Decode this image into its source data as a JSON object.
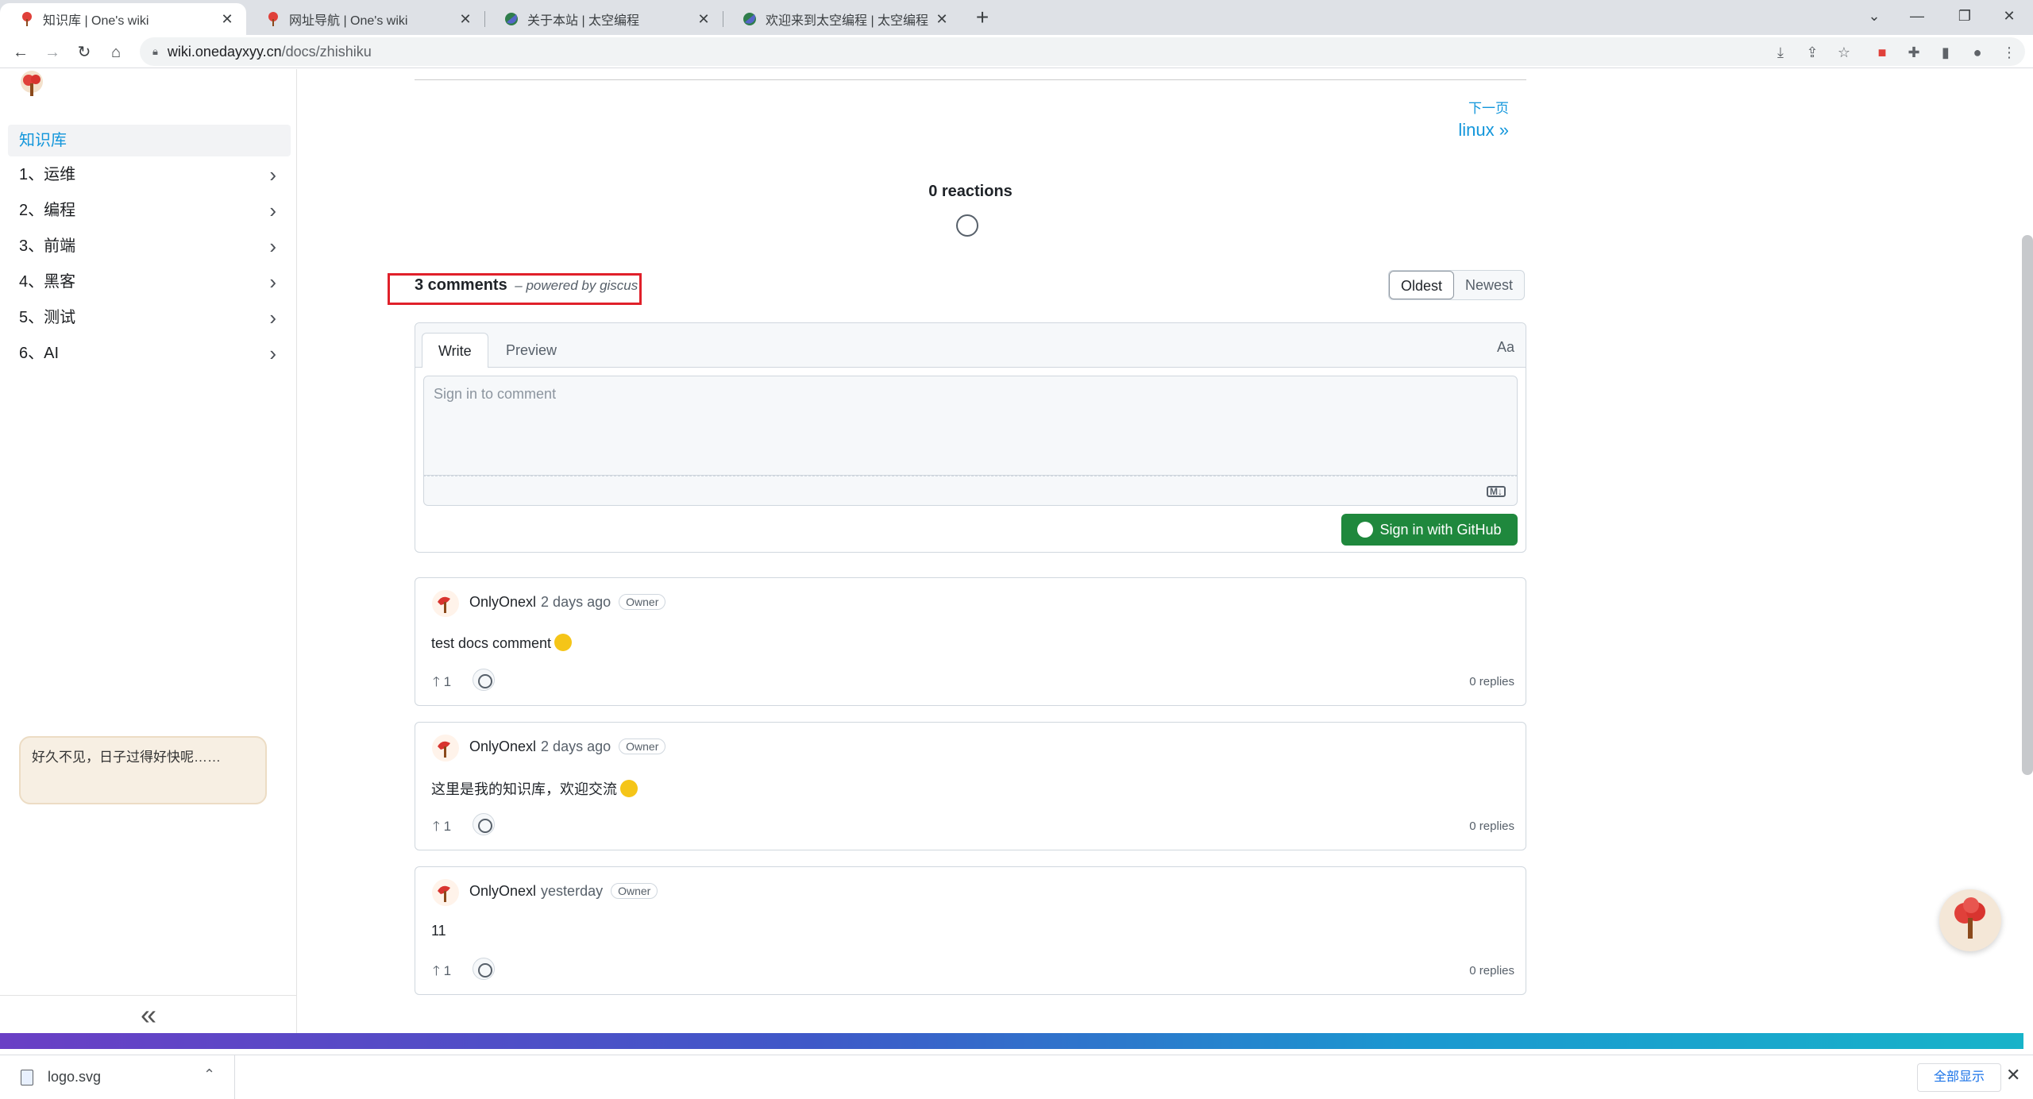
{
  "browser": {
    "tabs": [
      {
        "title": "知识库 | One's wiki",
        "active": true
      },
      {
        "title": "网址导航 | One's wiki",
        "active": false
      },
      {
        "title": "关于本站 | 太空编程",
        "active": false
      },
      {
        "title": "欢迎来到太空编程 | 太空编程",
        "active": false
      }
    ],
    "new_tab": "+",
    "url_host": "wiki.onedayxyy.cn",
    "url_path": "/docs/zhishiku"
  },
  "sidebar": {
    "active_item": "知识库",
    "items": [
      {
        "label": "1、运维"
      },
      {
        "label": "2、编程"
      },
      {
        "label": "3、前端"
      },
      {
        "label": "4、黑客"
      },
      {
        "label": "5、测试"
      },
      {
        "label": "6、AI"
      }
    ],
    "bubble_text": "好久不见，日子过得好快呢……",
    "collapse_glyph": "«"
  },
  "pager": {
    "next_sub": "下一页",
    "next_label": "linux »"
  },
  "reactions": {
    "label": "0 reactions"
  },
  "comments": {
    "count_label": "3 comments",
    "powered_by": "– powered by giscus",
    "sort_oldest": "Oldest",
    "sort_newest": "Newest",
    "editor": {
      "tab_write": "Write",
      "tab_preview": "Preview",
      "aa_label": "Aa",
      "placeholder": "Sign in to comment",
      "md_icon": "M↓",
      "signin_label": "Sign in with GitHub"
    },
    "list": [
      {
        "author": "OnlyOnexl",
        "time": "2 days ago",
        "badge": "Owner",
        "body": "test docs comment",
        "upvotes": "1",
        "replies": "0 replies"
      },
      {
        "author": "OnlyOnexl",
        "time": "2 days ago",
        "badge": "Owner",
        "body": "这里是我的知识库，欢迎交流",
        "upvotes": "1",
        "replies": "0 replies"
      },
      {
        "author": "OnlyOnexl",
        "time": "yesterday",
        "badge": "Owner",
        "body": "11",
        "upvotes": "1",
        "replies": "0 replies"
      }
    ]
  },
  "download_bar": {
    "file_name": "logo.svg",
    "show_all": "全部显示"
  },
  "colors": {
    "accent": "#1296db",
    "github_green": "#1f883d",
    "highlight_box": "#e0202a"
  }
}
